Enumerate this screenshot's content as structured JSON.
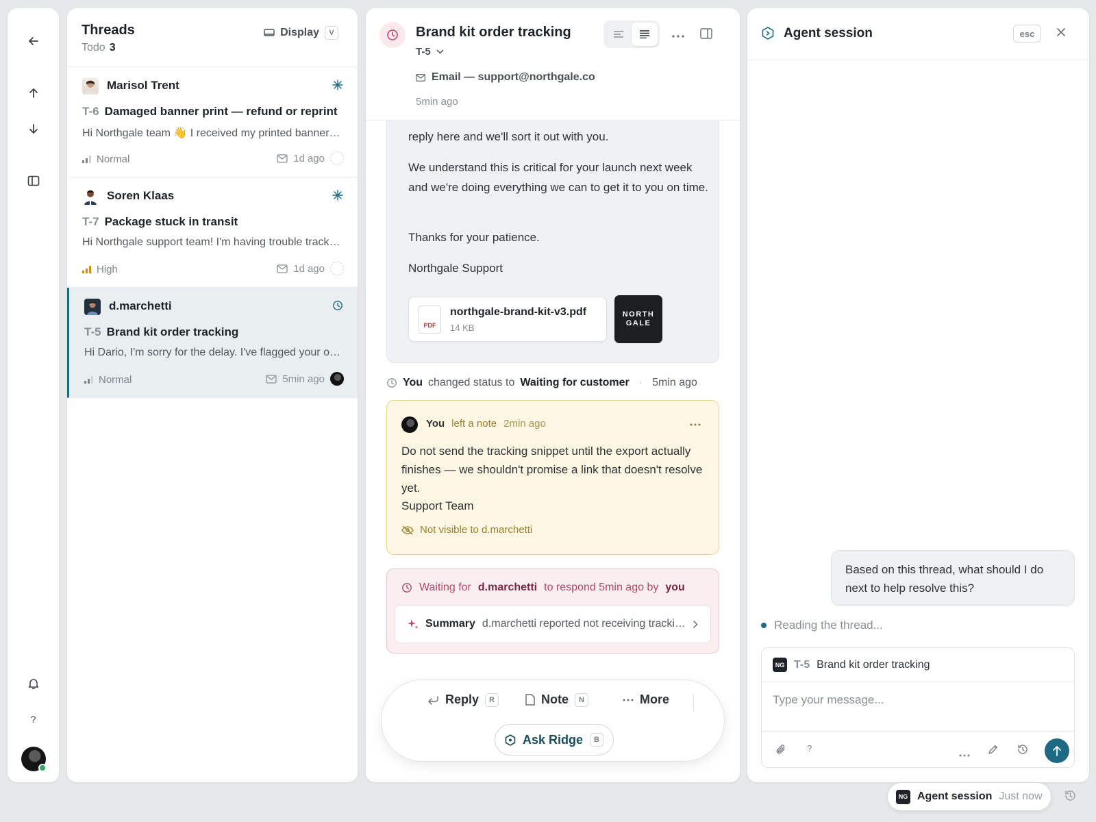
{
  "threads": {
    "title": "Threads",
    "filter_label": "Todo",
    "filter_count": "3",
    "display_label": "Display",
    "display_key": "V",
    "items": [
      {
        "name": "Marisol Trent",
        "id": "T-6",
        "subject": "Damaged banner print — refund or reprint",
        "preview": "Hi Northgale team 👋 I received my printed banner…",
        "priority": "Normal",
        "time": "1d ago"
      },
      {
        "name": "Soren Klaas",
        "id": "T-7",
        "subject": "Package stuck in transit",
        "preview": "Hi Northgale support team! I'm having trouble tracking…",
        "priority": "High",
        "time": "1d ago"
      },
      {
        "name": "d.marchetti",
        "id": "T-5",
        "subject": "Brand kit order tracking",
        "preview": "Hi Dario, I'm sorry for the delay. I've flagged your order…",
        "priority": "Normal",
        "time": "5min ago"
      }
    ]
  },
  "detail": {
    "title": "Brand kit order tracking",
    "id": "T-5",
    "channel": "Email — support@northgale.co",
    "time": "5min ago",
    "message": {
      "p1": "reply here and we'll sort it out with you.",
      "p2": "We understand this is critical for your launch next week and we're doing everything we can to get it to you on time.",
      "p3": "Thanks for your patience.",
      "p4": "Northgale Support",
      "attachment_name": "northgale-brand-kit-v3.pdf",
      "attachment_size": "14 KB",
      "attachment_type": "PDF",
      "logo_line1": "NORTH",
      "logo_line2": "GALE"
    },
    "event": {
      "actor": "You",
      "text": "changed status to",
      "status": "Waiting for customer",
      "sep": "·",
      "time": "5min ago"
    },
    "note": {
      "author": "You",
      "action": "left a note",
      "time": "2min ago",
      "body": "Do not send the tracking snippet until the export actually finishes — we shouldn't promise a link that doesn't resolve yet.",
      "signature": "Support Team",
      "visibility": "Not visible to d.marchetti"
    },
    "waiting": {
      "prefix": "Waiting for",
      "who": "d.marchetti",
      "mid": "to respond 5min ago by",
      "by": "you",
      "summary_label": "Summary",
      "summary_text": "d.marchetti reported not receiving tracking info for their brand kit order"
    },
    "composer": {
      "reply": "Reply",
      "reply_key": "R",
      "note": "Note",
      "note_key": "N",
      "more": "More",
      "ask": "Ask Ridge",
      "ask_key": "B"
    }
  },
  "agent": {
    "title": "Agent session",
    "esc": "esc",
    "user_message": "Based on this thread, what should I do next to help resolve this?",
    "status": "Reading the thread...",
    "context_badge": "NG",
    "context_id": "T-5",
    "context_title": "Brand kit order tracking",
    "placeholder": "Type your message...",
    "help": "?"
  },
  "pill": {
    "badge": "NG",
    "label": "Agent session",
    "time": "Just now"
  },
  "rail": {
    "help": "?"
  },
  "colors": {
    "accent": "#1e6a82",
    "note_bg": "#fdf6e2",
    "waiting_bg": "#fbeef1",
    "high_priority": "#d98a1c"
  }
}
